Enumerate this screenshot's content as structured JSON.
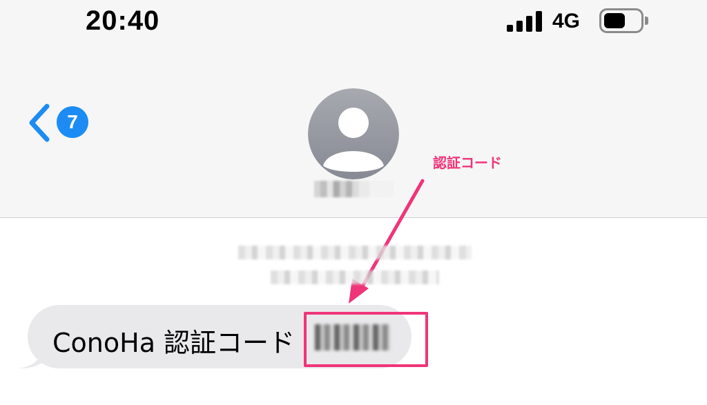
{
  "status_bar": {
    "time": "20:40",
    "network": "4G",
    "icons": [
      "signal-bars-icon",
      "battery-icon"
    ]
  },
  "nav": {
    "back_icon": "chevron-left-icon",
    "unread_count": "7",
    "avatar_icon": "person-placeholder-icon"
  },
  "annotation": {
    "label": "認証コード",
    "color": "#f0347a"
  },
  "message": {
    "text": "ConoHa 認証コード"
  },
  "colors": {
    "accent": "#1c8cf4",
    "bubble": "#e9e9eb",
    "header_bg": "#f6f6f6"
  }
}
